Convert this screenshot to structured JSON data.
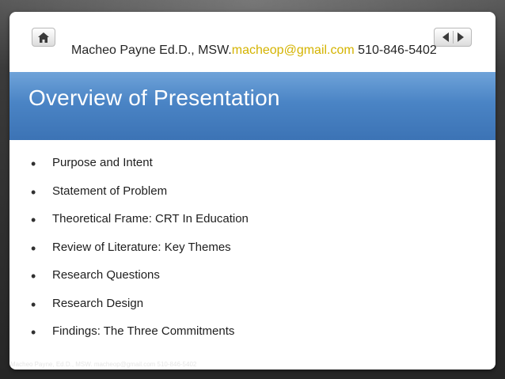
{
  "header": {
    "name": "Macheo Payne Ed.D., MSW.",
    "email": "macheop@gmail.com",
    "phone": "510-846-5402"
  },
  "title": "Overview of Presentation",
  "bullets": [
    "Purpose and Intent",
    "Statement of Problem",
    "Theoretical Frame: CRT In Education",
    "Review of Literature: Key Themes",
    "Research Questions",
    "Research Design",
    "Findings: The Three Commitments"
  ],
  "footer": "Macheo Payne, Ed.D., MSW. macheop@gmail.com 510-846-5402",
  "icons": {
    "home": "home-icon",
    "prev": "prev-arrow-icon",
    "next": "next-arrow-icon",
    "bullet": "bullet-icon"
  },
  "colors": {
    "title_bar": "#4a84c5",
    "email": "#d4b300",
    "title_text": "#ffffff"
  }
}
